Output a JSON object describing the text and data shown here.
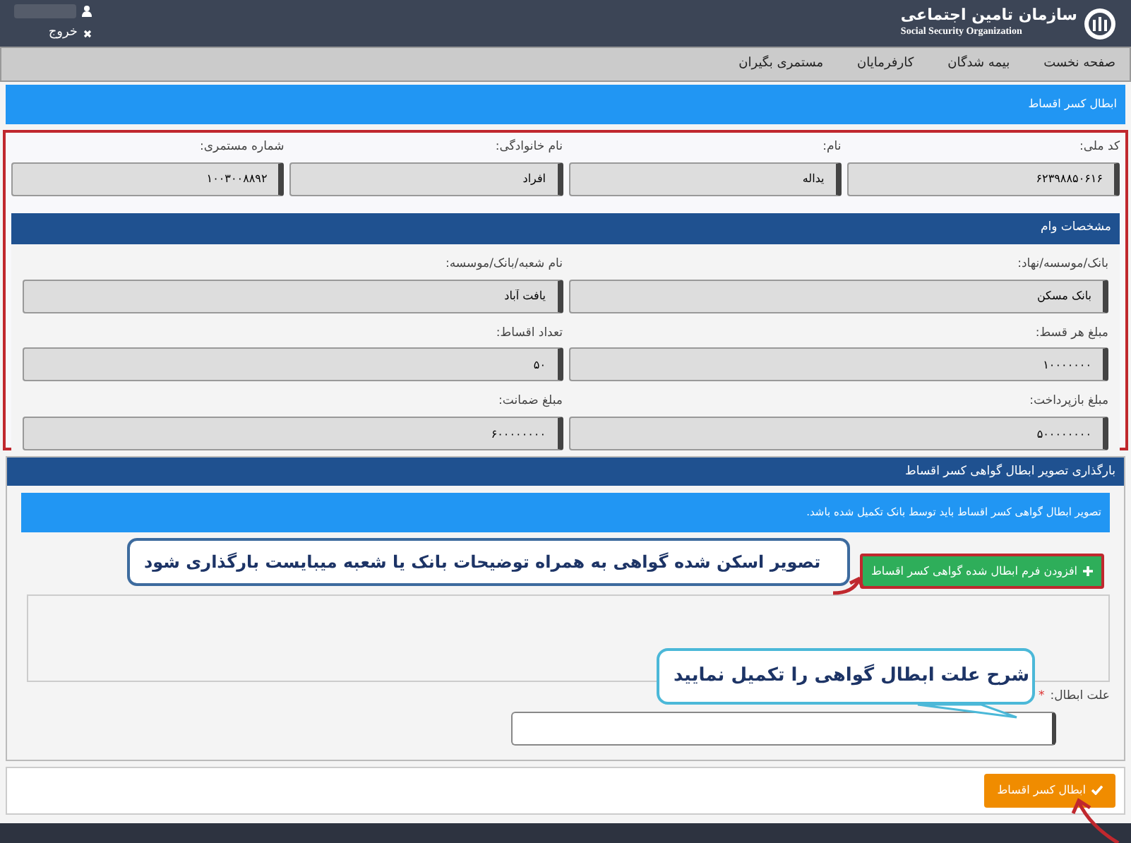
{
  "header": {
    "logo_title": "سازمان تامین اجتماعی",
    "logo_subtitle": "Social Security Organization",
    "logout": "خروج"
  },
  "nav": [
    {
      "label": "صفحه نخست"
    },
    {
      "label": "بیمه شدگان"
    },
    {
      "label": "کارفرمایان"
    },
    {
      "label": "مستمری بگیران"
    }
  ],
  "page_title": "ابطال کسر اقساط",
  "personal": [
    {
      "label": "کد ملی:",
      "value": "۶۲۳۹۸۸۵۰۶۱۶"
    },
    {
      "label": "نام:",
      "value": "یداله"
    },
    {
      "label": "نام خانوادگی:",
      "value": "افراد"
    },
    {
      "label": "شماره مستمری:",
      "value": "۱۰۰۳۰۰۸۸۹۲"
    }
  ],
  "loan": {
    "title": "مشخصات وام",
    "fields": [
      {
        "label": "بانک/موسسه/نهاد:",
        "value": "بانک مسکن"
      },
      {
        "label": "نام شعبه/بانک/موسسه:",
        "value": "یافت آباد"
      },
      {
        "label": "مبلغ هر قسط:",
        "value": "۱۰۰۰۰۰۰۰"
      },
      {
        "label": "تعداد اقساط:",
        "value": "۵۰"
      },
      {
        "label": "مبلغ بازپرداخت:",
        "value": "۵۰۰۰۰۰۰۰۰"
      },
      {
        "label": "مبلغ ضمانت:",
        "value": "۶۰۰۰۰۰۰۰۰"
      }
    ]
  },
  "upload": {
    "title": "بارگذاری تصویر ابطال گواهی کسر اقساط",
    "info": "تصویر ابطال گواهی کسر اقساط باید توسط بانک تکمیل شده باشد.",
    "add_button": "افزودن فرم ابطال شده گواهی کسر اقساط",
    "reason_label": "علت ابطال:",
    "required_mark": "*"
  },
  "submit_button": "ابطال کسر اقساط",
  "annotations": [
    {
      "kind": "box",
      "text": "تصویر اسکن شده گواهی به همراه توضیحات بانک یا شعبه میبایست بارگذاری شود"
    },
    {
      "kind": "bubble",
      "text": "شرح علت ابطال گواهی را تکمیل نمایید"
    }
  ]
}
